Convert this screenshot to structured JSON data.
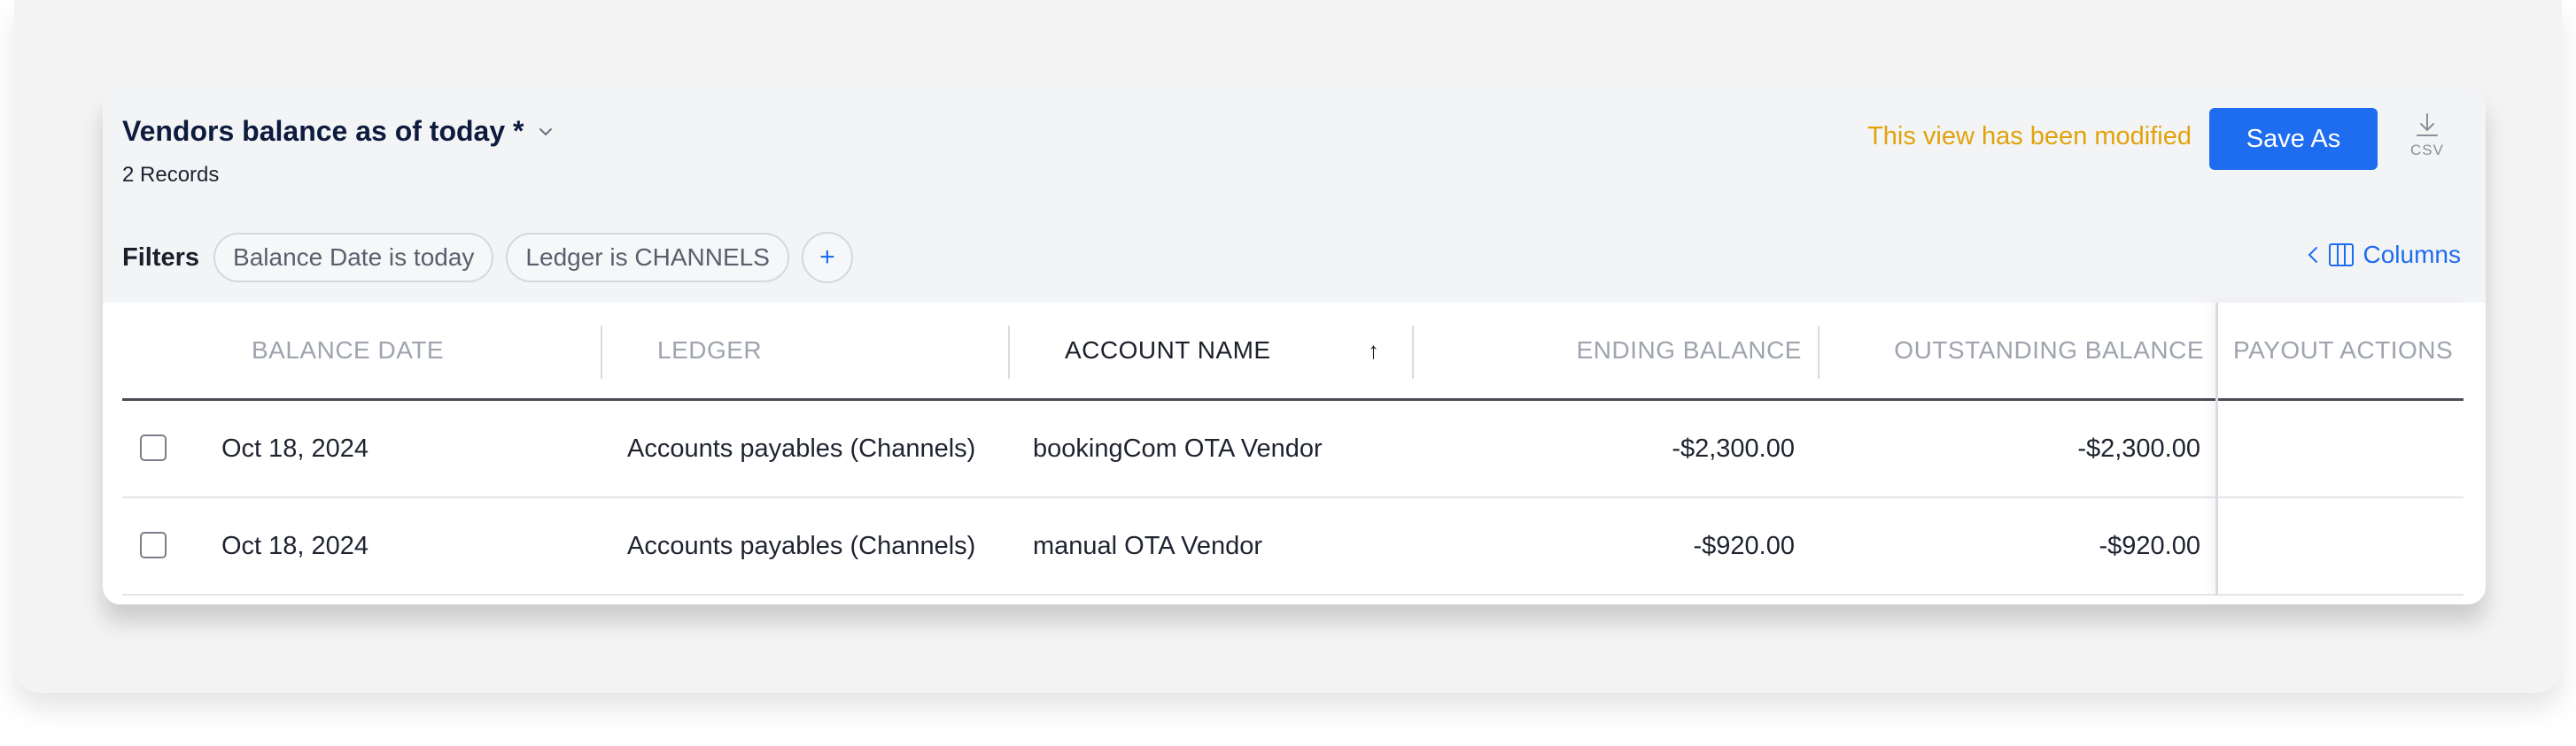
{
  "header": {
    "title": "Vendors balance as of today *",
    "records": "2 Records",
    "modified_notice": "This view has been modified",
    "save_label": "Save As",
    "csv_label": "CSV"
  },
  "filters": {
    "label": "Filters",
    "chips": [
      "Balance Date is today",
      "Ledger is CHANNELS"
    ],
    "add_label": "+",
    "columns_label": "Columns"
  },
  "table": {
    "columns": [
      "BALANCE DATE",
      "LEDGER",
      "ACCOUNT NAME",
      "ENDING BALANCE",
      "OUTSTANDING BALANCE",
      "PAYOUT ACTIONS"
    ],
    "sort_indicator": "↑",
    "rows": [
      {
        "date": "Oct 18, 2024",
        "ledger": "Accounts payables (Channels)",
        "account": "bookingCom OTA Vendor",
        "ending": "-$2,300.00",
        "outstanding": "-$2,300.00"
      },
      {
        "date": "Oct 18, 2024",
        "ledger": "Accounts payables (Channels)",
        "account": "manual OTA Vendor",
        "ending": "-$920.00",
        "outstanding": "-$920.00"
      }
    ]
  },
  "colors": {
    "accent": "#1e6cf0",
    "warning": "#e2a20c",
    "title": "#0d1b3e"
  }
}
